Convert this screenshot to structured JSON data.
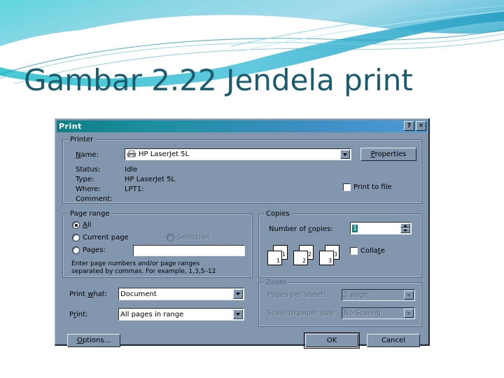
{
  "slide": {
    "title": "Gambar 2.22 Jendela print",
    "title_color": "#1b5b6e",
    "background_accent": "#3fc0d4"
  },
  "dialog": {
    "titlebar": {
      "title": "Print",
      "help_button": "?",
      "close_button": "✕"
    },
    "printer_group": {
      "legend": "Printer",
      "name_label": "Name:",
      "name_value": "HP LaserJet 5L",
      "properties_button": "Properties",
      "status_label": "Status:",
      "status_value": "Idle",
      "type_label": "Type:",
      "type_value": "HP LaserJet 5L",
      "where_label": "Where:",
      "where_value": "LPT1:",
      "comment_label": "Comment:",
      "comment_value": "",
      "print_to_file_label": "Print to file",
      "print_to_file_checked": false
    },
    "page_range_group": {
      "legend": "Page range",
      "all_label": "All",
      "all_selected": true,
      "current_page_label": "Current page",
      "selection_label": "Selection",
      "selection_disabled": true,
      "pages_label": "Pages:",
      "pages_value": "",
      "hint_line1": "Enter page numbers and/or page ranges",
      "hint_line2": "separated by commas.  For example, 1,3,5–12"
    },
    "copies_group": {
      "legend": "Copies",
      "number_label": "Number of copies:",
      "number_value": "1",
      "collate_label": "Collate",
      "collate_checked": false,
      "page_icons": [
        "1",
        "2",
        "3"
      ]
    },
    "print_what": {
      "label": "Print what:",
      "value": "Document"
    },
    "print_range": {
      "label": "Print:",
      "value": "All pages in range"
    },
    "zoom_group": {
      "legend": "Zoom",
      "disabled": true,
      "pages_per_sheet_label": "Pages per sheet:",
      "pages_per_sheet_value": "1 page",
      "scale_label": "Scale to paper size",
      "scale_value": "No Scaling"
    },
    "footer": {
      "options_button": "Options...",
      "ok_button": "OK",
      "cancel_button": "Cancel"
    }
  }
}
